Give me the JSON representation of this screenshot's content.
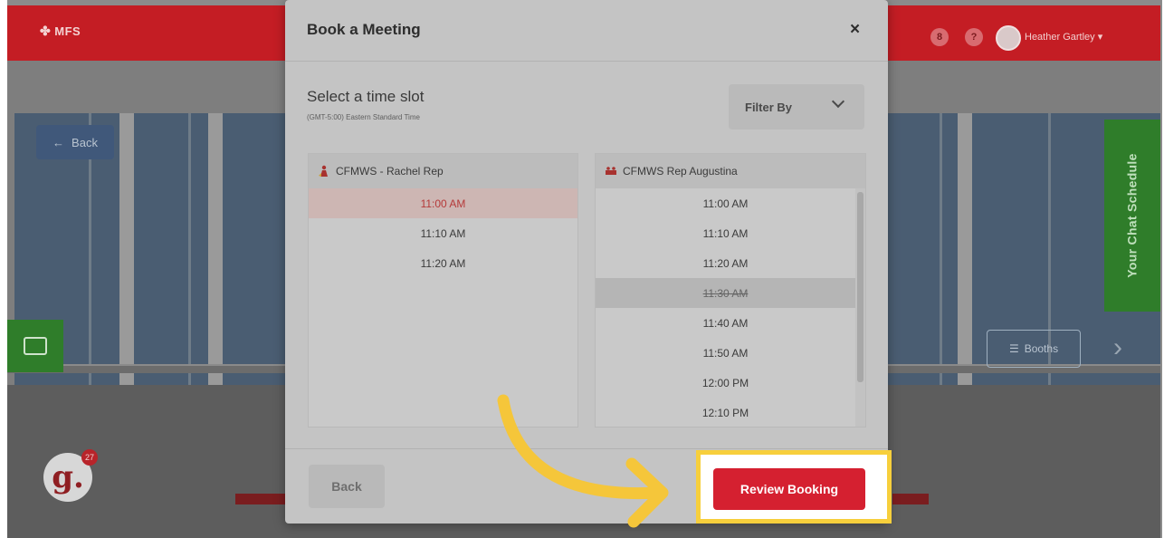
{
  "app": {
    "logo_text": "MFS",
    "user_name": "Heather Gartley",
    "topbar_icon_1": "8",
    "topbar_icon_2": "?",
    "back_label": "Back",
    "schedule_tab": "Your Chat Schedule",
    "booths_label": "Booths",
    "notification_count": "27",
    "badge_letter": "g."
  },
  "modal": {
    "title": "Book a Meeting",
    "close_label": "×",
    "slot_heading": "Select a time slot",
    "timezone": "(GMT-5:00) Eastern Standard Time",
    "filter_label": "Filter By",
    "left_rep": {
      "name": "CFMWS - Rachel Rep",
      "slots": [
        "11:00 AM",
        "11:10 AM",
        "11:20 AM"
      ],
      "selected_index": 0
    },
    "right_rep": {
      "name": "CFMWS Rep Augustina",
      "slots": [
        "11:00 AM",
        "11:10 AM",
        "11:20 AM",
        "11:30 AM",
        "11:40 AM",
        "11:50 AM",
        "12:00 PM",
        "12:10 PM"
      ],
      "booked_index": 3
    },
    "back_button": "Back",
    "review_button": "Review Booking"
  },
  "colors": {
    "brand_red": "#c41d24",
    "cta_red": "#d52030",
    "highlight_yellow": "#f7cf3c",
    "side_green": "#2f7d2a"
  },
  "icons": [
    "chat-icon",
    "menu-icon",
    "chevron-right-icon",
    "chevron-down-icon",
    "close-icon",
    "arrow-left-icon",
    "rep-icon"
  ]
}
